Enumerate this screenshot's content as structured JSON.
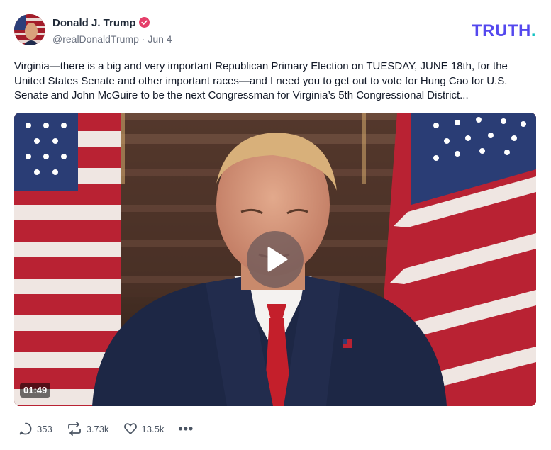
{
  "post": {
    "author": {
      "name": "Donald J. Trump",
      "handle": "@realDonaldTrump",
      "date": "Jun 4",
      "verified": true
    },
    "brand": {
      "name": "TRUTH",
      "dot": ".",
      "color": "#5448ee",
      "dot_color": "#12c2c2"
    },
    "text": "Virginia—there is a big and very important Republican Primary Election on TUESDAY, JUNE 18th, for the United States Senate and other important races—and I need you to get out to vote for Hung Cao for U.S. Senate and John McGuire to be the next Congressman for Virginia’s 5th Congressional District...",
    "video": {
      "duration": "01:49",
      "play_icon": "play-icon"
    },
    "stats": {
      "replies": "353",
      "retruths": "3.73k",
      "likes": "13.5k",
      "more": "•••"
    }
  }
}
